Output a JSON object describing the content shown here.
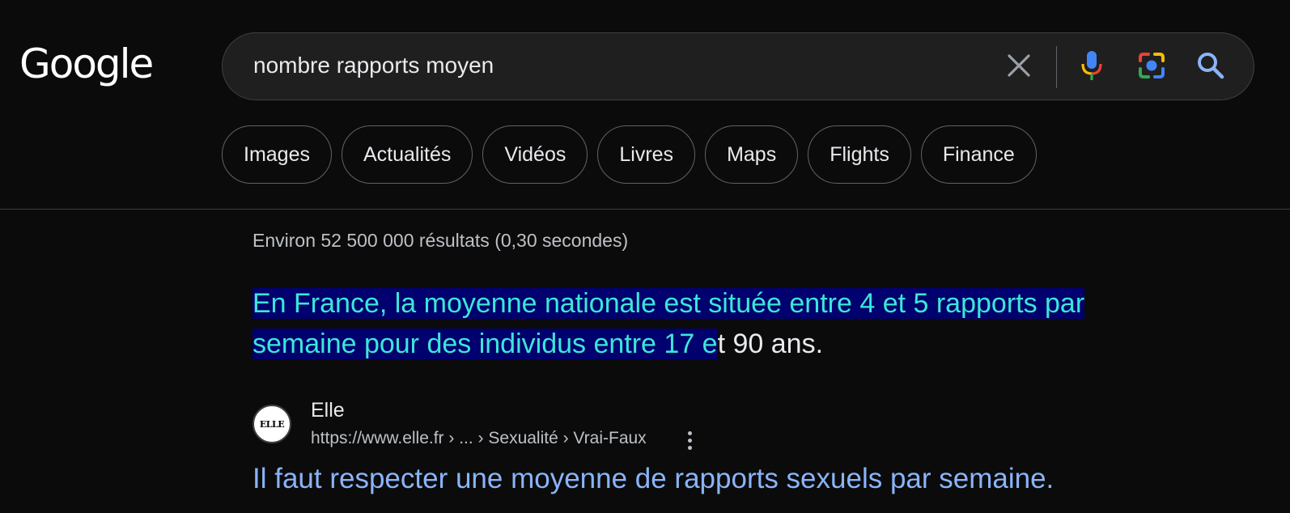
{
  "logo": {
    "text": "Google"
  },
  "search": {
    "query": "nombre rapports moyen",
    "icons": [
      "close-icon",
      "mic-icon",
      "camera-lens-icon",
      "search-icon"
    ]
  },
  "chips": [
    {
      "label": "Images"
    },
    {
      "label": "Actualités"
    },
    {
      "label": "Vidéos"
    },
    {
      "label": "Livres"
    },
    {
      "label": "Maps"
    },
    {
      "label": "Flights"
    },
    {
      "label": "Finance"
    }
  ],
  "stats": "Environ 52 500 000 résultats (0,30 secondes)",
  "featured_snippet": {
    "highlighted": "En France, la moyenne nationale est située entre 4 et 5 rapports par semaine pour des individus entre 17 e",
    "rest": "t 90 ans."
  },
  "result": {
    "favicon_text": "ELLE",
    "site_name": "Elle",
    "url": "https://www.elle.fr › ... › Sexualité › Vrai-Faux",
    "title": "Il faut respecter une moyenne de rapports sexuels par semaine."
  },
  "colors": {
    "background": "#0b0b0b",
    "highlight_bg": "#00006e",
    "highlight_text": "#3ce6d8",
    "link": "#8ab4f8"
  }
}
